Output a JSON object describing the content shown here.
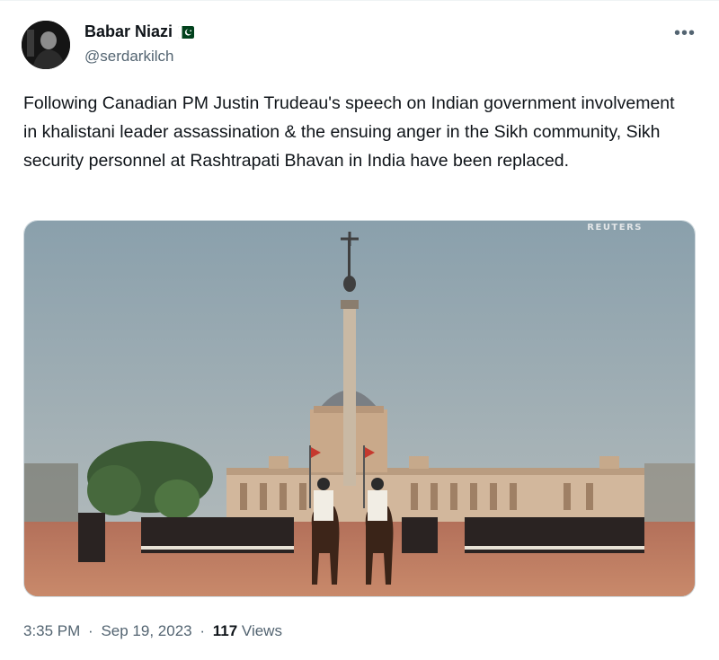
{
  "author": {
    "display_name": "Babar Niazi",
    "handle": "@serdarkilch",
    "flag_icon": "pakistan-flag-icon"
  },
  "menu": {
    "more_label": "•••"
  },
  "tweet": {
    "text": "Following Canadian PM Justin Trudeau's speech on Indian government involvement in khalistani  leader assassination & the ensuing anger in the Sikh community, Sikh security personnel at Rashtrapati Bhavan in India have been replaced."
  },
  "media": {
    "watermark": "REUTERS",
    "sky_color": "#8fa3ae",
    "ground_color": "#c07d60"
  },
  "footer": {
    "time": "3:35 PM",
    "date": "Sep 19, 2023",
    "views_count": "117",
    "views_label": "Views",
    "separator": "·"
  }
}
